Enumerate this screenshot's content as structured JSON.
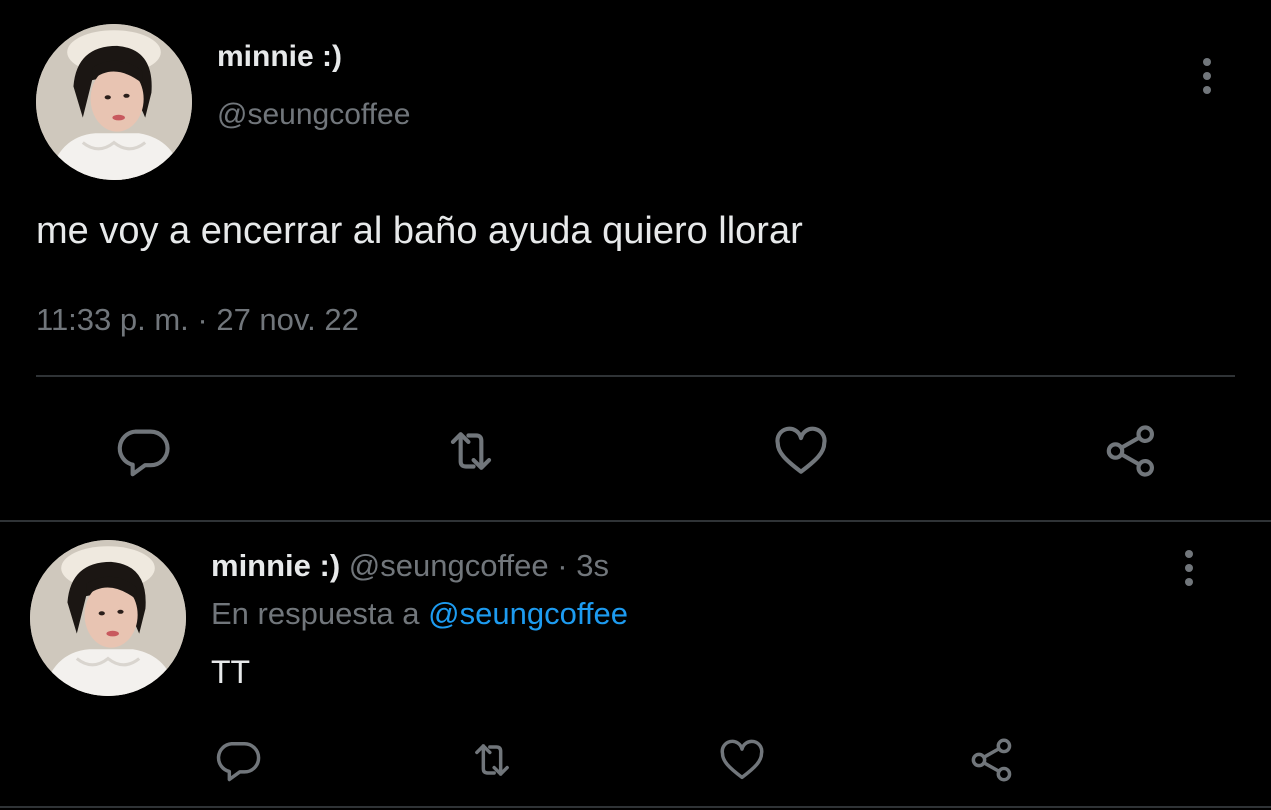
{
  "main_tweet": {
    "author_name": "minnie :)",
    "author_handle": "@seungcoffee",
    "text": "me voy a encerrar al baño ayuda quiero llorar",
    "timestamp": "11:33 p. m. · 27 nov. 22"
  },
  "reply_tweet": {
    "author_name": "minnie :)",
    "author_handle": "@seungcoffee",
    "separator": "·",
    "time_ago": "3s",
    "replying_to_prefix": "En respuesta a",
    "replying_to_handle": "@seungcoffee",
    "text": "TT"
  },
  "icons": {
    "reply": "comment-bubble-icon",
    "retweet": "retweet-icon",
    "like": "heart-icon",
    "share": "share-icon",
    "more": "more-vertical-icon"
  },
  "colors": {
    "background": "#000000",
    "primary_text": "#e7e9ea",
    "secondary_text": "#71767b",
    "link": "#1d9bf0",
    "divider": "#2f3336",
    "icon": "#71767b"
  }
}
